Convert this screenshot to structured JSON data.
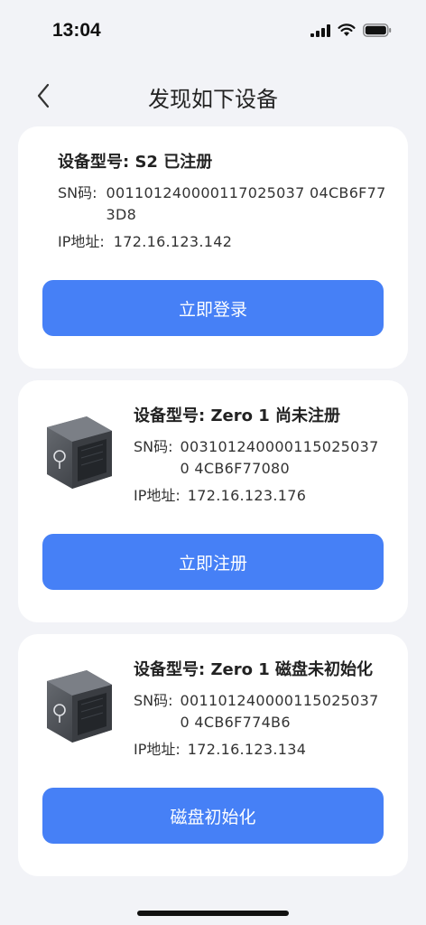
{
  "status_bar": {
    "time": "13:04"
  },
  "nav": {
    "title": "发现如下设备"
  },
  "devices": [
    {
      "title": "设备型号: S2 已注册",
      "sn_label": "SN码:",
      "sn_value": "001101240000117025037 04CB6F773D8",
      "ip_label": "IP地址:",
      "ip_value": "172.16.123.142",
      "button": "立即登录"
    },
    {
      "title": "设备型号: Zero 1 尚未注册",
      "sn_label": "SN码:",
      "sn_value": "0031012400001150250370 4CB6F77080",
      "ip_label": "IP地址:",
      "ip_value": "172.16.123.176",
      "button": "立即注册"
    },
    {
      "title": "设备型号: Zero 1 磁盘未初始化",
      "sn_label": "SN码:",
      "sn_value": "0011012400001150250370 4CB6F774B6",
      "ip_label": "IP地址:",
      "ip_value": "172.16.123.134",
      "button": "磁盘初始化"
    }
  ],
  "colors": {
    "accent": "#4680f6",
    "background": "#f2f3f7",
    "card": "#ffffff"
  }
}
